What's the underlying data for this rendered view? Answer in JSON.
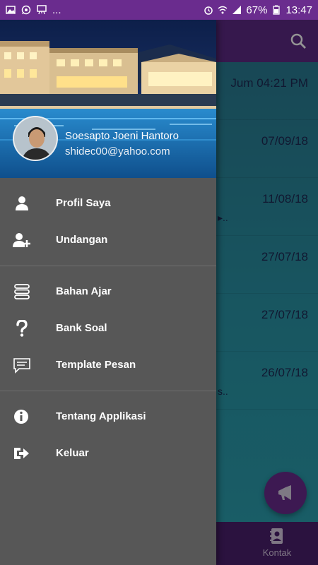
{
  "status_bar": {
    "left_overflow": "...",
    "battery": "67%",
    "time": "13:47",
    "icons": [
      "gallery-icon",
      "whatsapp-icon",
      "presentation-icon",
      "alarm-icon",
      "wifi-icon",
      "signal-icon",
      "battery-icon"
    ]
  },
  "app": {
    "toolbar": {
      "search_icon": "search-icon",
      "color": "#5e2a86"
    },
    "list": [
      {
        "date": "Jum 04:21 PM",
        "snippet": ""
      },
      {
        "date": "07/09/18",
        "snippet": ""
      },
      {
        "date": "11/08/18",
        "snippet": "▸.."
      },
      {
        "date": "27/07/18",
        "snippet": ""
      },
      {
        "date": "27/07/18",
        "snippet": ""
      },
      {
        "date": "26/07/18",
        "snippet": "s.."
      }
    ],
    "fab_icon": "megaphone-icon",
    "bottom_nav": {
      "kontak_label": "Kontak",
      "kontak_icon": "contacts-icon"
    }
  },
  "drawer": {
    "user": {
      "name": "Soesapto Joeni Hantoro",
      "email": "shidec00@yahoo.com"
    },
    "sections": [
      [
        {
          "label": "Profil Saya",
          "icon": "person-icon"
        },
        {
          "label": "Undangan",
          "icon": "add-person-icon"
        }
      ],
      [
        {
          "label": "Bahan Ajar",
          "icon": "stack-icon"
        },
        {
          "label": "Bank Soal",
          "icon": "question-icon"
        },
        {
          "label": "Template Pesan",
          "icon": "message-icon"
        }
      ],
      [
        {
          "label": "Tentang Applikasi",
          "icon": "info-icon"
        },
        {
          "label": "Keluar",
          "icon": "logout-icon"
        }
      ]
    ]
  },
  "colors": {
    "accent": "#6a2c8e",
    "drawer_bg": "#575757",
    "date_text": "#1e2a55"
  }
}
